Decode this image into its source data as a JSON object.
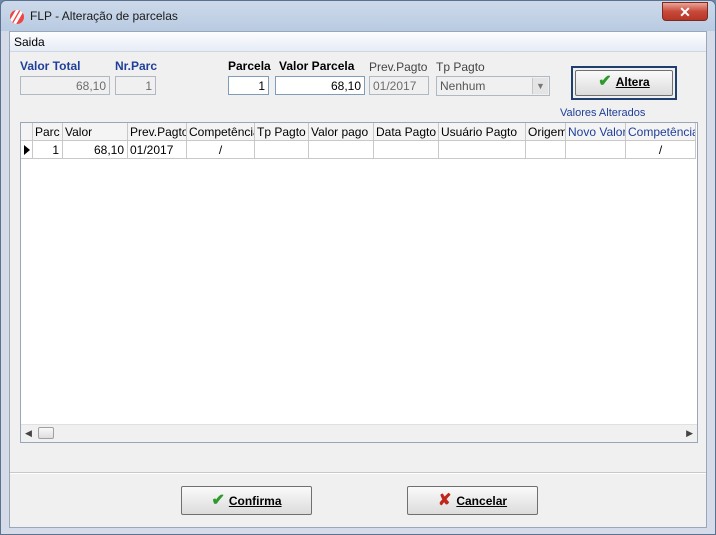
{
  "window": {
    "title": "FLP - Alteração de parcelas",
    "close_glyph": "✕"
  },
  "menu": {
    "saida": "Saida"
  },
  "form": {
    "valor_total_label": "Valor Total",
    "valor_total_value": "68,10",
    "nr_parc_label": "Nr.Parc",
    "nr_parc_value": "1",
    "parcela_label": "Parcela",
    "parcela_value": "1",
    "valor_parcela_label": "Valor Parcela",
    "valor_parcela_value": "68,10",
    "prev_pagto_label": "Prev.Pagto",
    "prev_pagto_value": "01/2017",
    "tp_pagto_label": "Tp Pagto",
    "tp_pagto_value": "Nenhum"
  },
  "buttons": {
    "altera": "Altera",
    "confirma": "Confirma",
    "cancelar": "Cancelar"
  },
  "valores_alterados": "Valores Alterados",
  "grid": {
    "columns": [
      "Parc",
      "Valor",
      "Prev.Pagto",
      "Competência",
      "Tp Pagto",
      "Valor pago",
      "Data Pagto",
      "Usuário Pagto",
      "Origem",
      "Novo Valor",
      "Competência"
    ],
    "rows": [
      [
        "1",
        "68,10",
        "01/2017",
        "/",
        "",
        "",
        "",
        "",
        "",
        "",
        "/"
      ]
    ]
  },
  "colors": {
    "accent_blue": "#1f3f9a",
    "check_green": "#2c9a2c",
    "cancel_red": "#c0261c"
  },
  "icons": {
    "app": "flp-logo-icon",
    "close": "close-icon",
    "check": "check-icon",
    "cancel": "x-icon"
  }
}
